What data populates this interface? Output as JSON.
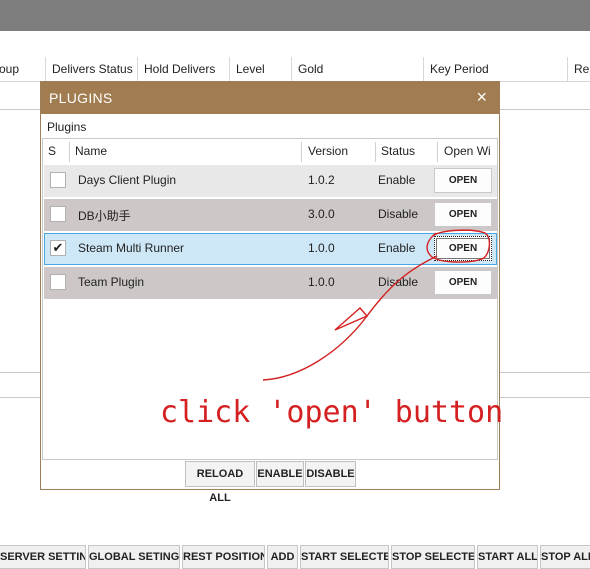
{
  "grid_header": {
    "columns": [
      "oup",
      "Delivers Status",
      "Hold Delivers",
      "Level",
      "Gold",
      "Key Period",
      "Rer"
    ]
  },
  "dialog": {
    "title": "PLUGINS",
    "close_icon": "×",
    "group_label": "Plugins",
    "list_headers": [
      "S",
      "Name",
      "Version",
      "Status",
      "Open Wi"
    ],
    "rows": [
      {
        "checked": false,
        "name": "Days Client Plugin",
        "version": "1.0.2",
        "status": "Enable",
        "action": "OPEN"
      },
      {
        "checked": false,
        "name": "DB小助手",
        "version": "3.0.0",
        "status": "Disable",
        "action": "OPEN"
      },
      {
        "checked": true,
        "name": "Steam Multi Runner",
        "version": "1.0.0",
        "status": "Enable",
        "action": "OPEN"
      },
      {
        "checked": false,
        "name": "Team Plugin",
        "version": "1.0.0",
        "status": "Disable",
        "action": "OPEN"
      }
    ],
    "buttons": {
      "reload_all": "RELOAD ALL",
      "enable": "ENABLE",
      "disable": "DISABLE"
    }
  },
  "bottom_toolbar": [
    "SERVER SETTINGS",
    "GLOBAL SETINGS",
    "REST POSITION",
    "ADD",
    "START SELECTED",
    "STOP SELECTED",
    "START ALL",
    "STOP ALL"
  ],
  "annotation": {
    "text": "click 'open' button",
    "color": "#d42020"
  },
  "colors": {
    "title_bar": "#a07c50",
    "selected_row": "#cde7f6",
    "selected_border": "#4aa6e0"
  }
}
